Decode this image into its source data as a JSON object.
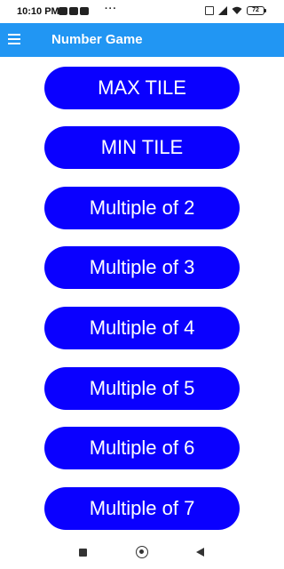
{
  "status_bar": {
    "time": "10:10 PM",
    "dots": "···",
    "battery": "72"
  },
  "app_bar": {
    "title": "Number Game",
    "menu_icon": "hamburger-menu-icon"
  },
  "buttons": [
    {
      "label": "MAX TILE"
    },
    {
      "label": "MIN TILE"
    },
    {
      "label": "Multiple of 2"
    },
    {
      "label": "Multiple of 3"
    },
    {
      "label": "Multiple of 4"
    },
    {
      "label": "Multiple of 5"
    },
    {
      "label": "Multiple of 6"
    },
    {
      "label": "Multiple of 7"
    }
  ],
  "colors": {
    "app_bar": "#2196f3",
    "button": "#0a00ff",
    "button_text": "#ffffff"
  },
  "nav_bar": {
    "icons": [
      "recents-square-icon",
      "home-circle-icon",
      "back-triangle-icon"
    ]
  }
}
